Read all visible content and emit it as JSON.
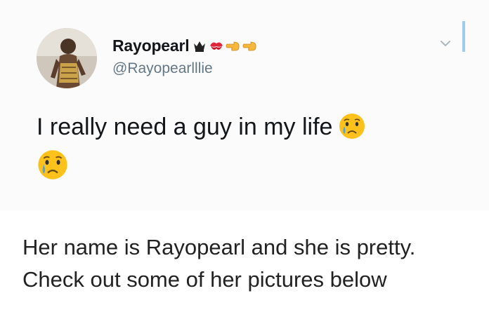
{
  "tweet": {
    "display_name": "Rayopearl",
    "name_emojis": [
      "crown-icon",
      "kiss-mark-icon",
      "pointing-left-icon",
      "pointing-left-icon"
    ],
    "handle": "@Rayopearlllie",
    "text": "I really need a guy in my life",
    "trailing_emojis": [
      "crying-face-icon",
      "crying-face-icon"
    ]
  },
  "caption": {
    "line1": "Her name is Rayopearl and she is pretty.",
    "line2": "Check out some of her pictures below"
  },
  "colors": {
    "handle": "#657786",
    "text": "#14171a",
    "accent": "#9fcbee"
  }
}
